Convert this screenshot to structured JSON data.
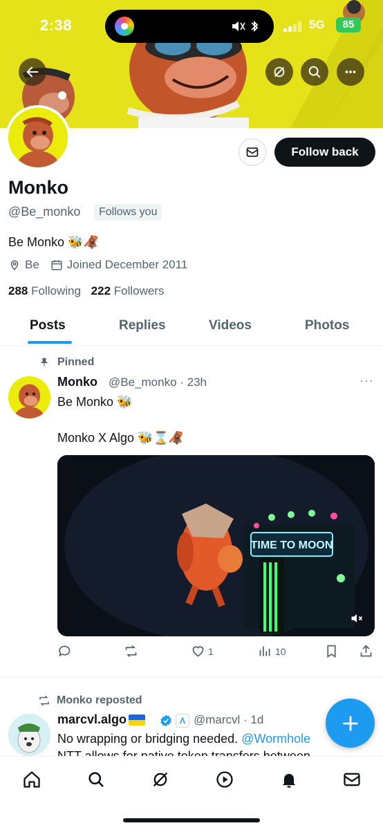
{
  "status": {
    "time": "2:38",
    "network": "5G",
    "battery": "85"
  },
  "profile": {
    "name": "Monko",
    "handle": "@Be_monko",
    "follows_you": "Follows you",
    "bio": "Be Monko 🐝🦧",
    "location": "Be",
    "joined": "Joined December 2011",
    "following_count": "288",
    "following_label": "Following",
    "followers_count": "222",
    "followers_label": "Followers",
    "follow_back_label": "Follow back"
  },
  "tabs": [
    "Posts",
    "Replies",
    "Videos",
    "Photos"
  ],
  "pinned_post": {
    "pinned_label": "Pinned",
    "author_name": "Monko",
    "author_meta": "@Be_monko · 23h",
    "more": "···",
    "line1": "Be Monko 🐝",
    "line2": "Monko X Algo 🐝⌛🦧",
    "media_sign": "TIME TO MOON",
    "likes": "1",
    "views": "10"
  },
  "repost": {
    "repost_label": "Monko reposted",
    "author_name": "marcvl.algo",
    "affiliate_badge": "Λ",
    "author_meta": "@marcvl · 1d",
    "line1_text": "No wrapping or bridging needed. ",
    "line1_mention": "@Wormhole",
    "line2_text": "NTT allows for native token transfers between"
  },
  "colors": {
    "accent": "#1d9bf0",
    "banner": "#e9e41a",
    "text": "#0f1419",
    "muted": "#536471"
  }
}
